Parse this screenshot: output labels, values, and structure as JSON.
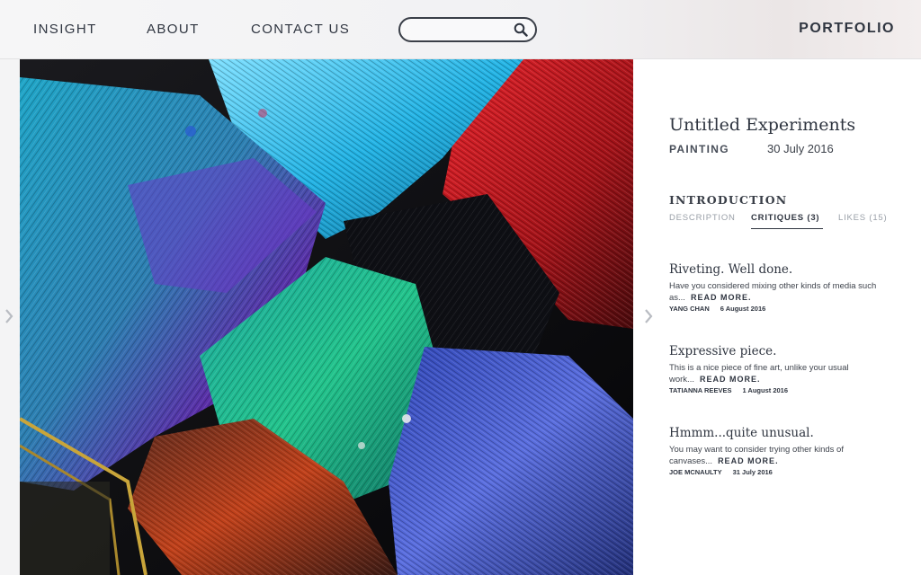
{
  "header": {
    "nav": [
      "INSIGHT",
      "ABOUT",
      "CONTACT US"
    ],
    "search": {
      "value": "",
      "placeholder": "",
      "icon": "search-icon"
    },
    "brand": "PORTFOLIO"
  },
  "artwork": {
    "description_icons": {
      "prev": "chevron-left-icon",
      "next": "chevron-right-icon"
    }
  },
  "detail": {
    "title": "Untitled Experiments",
    "category": "PAINTING",
    "date": "30 July 2016",
    "section_heading": "INTRODUCTION",
    "tabs": [
      {
        "label": "DESCRIPTION",
        "active": false
      },
      {
        "label": "CRITIQUES (3)",
        "active": true
      },
      {
        "label": "LIKES (15)",
        "active": false
      }
    ],
    "critiques": [
      {
        "title": "Riveting. Well done.",
        "excerpt": "Have you considered mixing other kinds of media such as...",
        "read_more": "READ MORE.",
        "author": "YANG CHAN",
        "date": "6 August 2016"
      },
      {
        "title": "Expressive piece.",
        "excerpt": "This is a nice piece of fine art, unlike your usual work...",
        "read_more": "READ MORE.",
        "author": "TATIANNA REEVES",
        "date": "1 August 2016"
      },
      {
        "title": "Hmmm...quite unusual.",
        "excerpt": "You may want to consider trying other kinds of canvases...",
        "read_more": "READ MORE.",
        "author": "JOE MCNAULTY",
        "date": "31 July 2016"
      }
    ]
  },
  "colors": {
    "text": "#2f3540",
    "muted": "#9aa0a8",
    "panel": "#ffffff",
    "header": "#f3f3f5"
  }
}
